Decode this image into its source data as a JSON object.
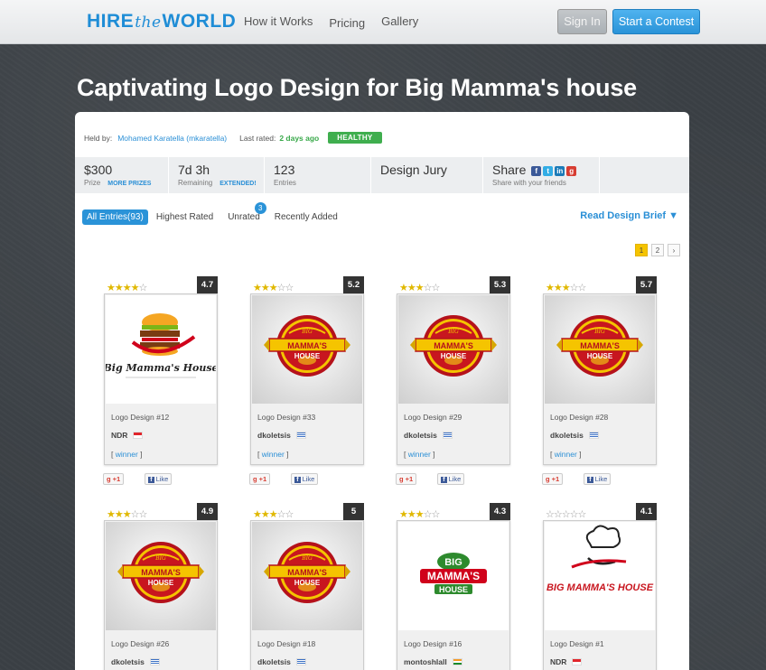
{
  "header": {
    "logo_hire": "HIRE",
    "logo_the": "the",
    "logo_world": "WORLD",
    "nav": [
      "How it Works",
      "Pricing",
      "Gallery"
    ],
    "signin": "Sign In",
    "start_contest": "Start a Contest"
  },
  "page_title": "Captivating Logo Design for Big Mamma's house",
  "meta": {
    "held_by_label": "Held by:",
    "held_by_name": "Mohamed Karatella (mkaratella)",
    "last_rated_label": "Last rated:",
    "last_rated_value": "2 days ago",
    "status": "HEALTHY"
  },
  "stats": {
    "prize": "$300",
    "prize_label": "Prize",
    "more_prizes": "MORE PRIZES",
    "remaining": "7d 3h",
    "remaining_label": "Remaining",
    "extended": "EXTENDED!",
    "entries": "123",
    "entries_label": "Entries",
    "jury": "Design Jury",
    "share": "Share",
    "share_label": "Share with your friends"
  },
  "tabs": {
    "all": "All Entries(93)",
    "highest": "Highest Rated",
    "unrated": "Unrated",
    "unrated_badge": "3",
    "recent": "Recently Added",
    "brief": "Read Design Brief ▼"
  },
  "pager": [
    "1",
    "2",
    "›"
  ],
  "social": {
    "gplus": "+1",
    "like": "Like"
  },
  "entries": [
    {
      "title": "Logo Design #12",
      "author": "NDR",
      "flag": "sg",
      "score": "4.7",
      "stars": 4,
      "winner": true,
      "thumb": "white"
    },
    {
      "title": "Logo Design #33",
      "author": "dkoletsis",
      "flag": "gr",
      "score": "5.2",
      "stars": 3,
      "winner": true,
      "thumb": "gray"
    },
    {
      "title": "Logo Design #29",
      "author": "dkoletsis",
      "flag": "gr",
      "score": "5.3",
      "stars": 3,
      "winner": true,
      "thumb": "gray"
    },
    {
      "title": "Logo Design #28",
      "author": "dkoletsis",
      "flag": "gr",
      "score": "5.7",
      "stars": 3,
      "winner": true,
      "thumb": "gray"
    },
    {
      "title": "Logo Design #26",
      "author": "dkoletsis",
      "flag": "gr",
      "score": "4.9",
      "stars": 3,
      "winner": false,
      "thumb": "gray"
    },
    {
      "title": "Logo Design #18",
      "author": "dkoletsis",
      "flag": "gr",
      "score": "5",
      "stars": 3,
      "winner": false,
      "thumb": "gray"
    },
    {
      "title": "Logo Design #16",
      "author": "montoshlall",
      "flag": "in",
      "score": "4.3",
      "stars": 3,
      "winner": false,
      "thumb": "white"
    },
    {
      "title": "Logo Design #1",
      "author": "NDR",
      "flag": "sg",
      "score": "4.1",
      "stars": 0,
      "winner": false,
      "thumb": "white"
    }
  ],
  "winner_text": "winner",
  "logo_texts": {
    "e12": "Big Mamma's House",
    "badge_top": "BIG",
    "badge_mid": "MAMMA'S",
    "badge_bot": "HOUSE",
    "e16_big": "BIG",
    "e16_mamma": "MAMMA'S",
    "e16_house": "HOUSE",
    "e1": "BIG MAMMA'S HOUSE"
  }
}
